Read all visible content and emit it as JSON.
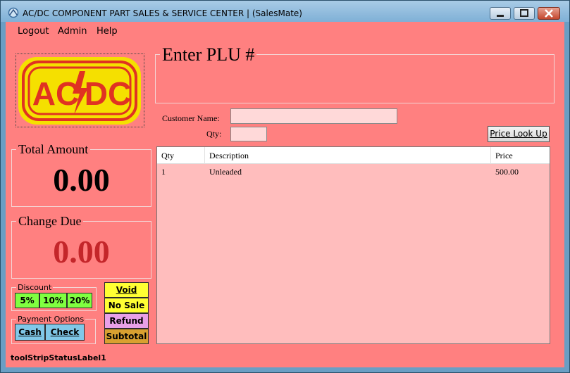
{
  "window": {
    "title": "AC/DC COMPONENT PART SALES & SERVICE CENTER | (SalesMate)"
  },
  "menu": [
    "Logout",
    "Admin",
    "Help"
  ],
  "logo": {
    "text_left": "AC",
    "text_right": "DC",
    "colors": {
      "bg": "#f5e000",
      "fg": "#e03222"
    }
  },
  "plu": {
    "legend": "Enter PLU #"
  },
  "customer": {
    "name_label": "Customer Name:",
    "name_value": "",
    "qty_label": "Qty:",
    "qty_value": ""
  },
  "price_lookup_label": "Price Look Up",
  "totals": {
    "total_legend": "Total Amount",
    "total_value": "0.00",
    "change_legend": "Change Due",
    "change_value": "0.00"
  },
  "discount": {
    "legend": "Discount",
    "options": [
      "5%",
      "10%",
      "20%"
    ]
  },
  "payment": {
    "legend": "Payment Options",
    "options": [
      "Cash",
      "Check"
    ]
  },
  "actions": {
    "void": "Void",
    "no_sale": "No Sale",
    "refund": "Refund",
    "subtotal": "Subtotal"
  },
  "grid": {
    "columns": [
      "Qty",
      "Description",
      "Price"
    ],
    "rows": [
      {
        "qty": "1",
        "description": "Unleaded",
        "price": "500.00"
      }
    ]
  },
  "status_label": "toolStripStatusLabel1",
  "colors": {
    "form_bg": "#ff8080",
    "change_value": "#c4262a",
    "discount_btn": "#80ff40",
    "payment_btn": "#80c8e8",
    "void_btn": "#ffff33",
    "refund_btn": "#e8a0e8",
    "subtotal_btn": "#d9a030"
  }
}
